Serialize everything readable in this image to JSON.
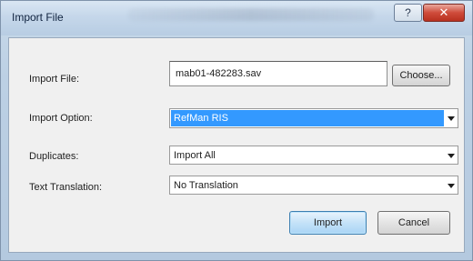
{
  "window": {
    "title": "Import File",
    "help_label": "?",
    "close_label": "✕",
    "accent_color": "#3399ff",
    "close_color": "#c8402f"
  },
  "form": {
    "import_file_label": "Import File:",
    "import_file_value": "mab01-482283.sav",
    "choose_label": "Choose...",
    "import_option_label": "Import Option:",
    "import_option_value": "RefMan RIS",
    "duplicates_label": "Duplicates:",
    "duplicates_value": "Import All",
    "text_translation_label": "Text Translation:",
    "text_translation_value": "No Translation"
  },
  "actions": {
    "import_label": "Import",
    "cancel_label": "Cancel"
  }
}
